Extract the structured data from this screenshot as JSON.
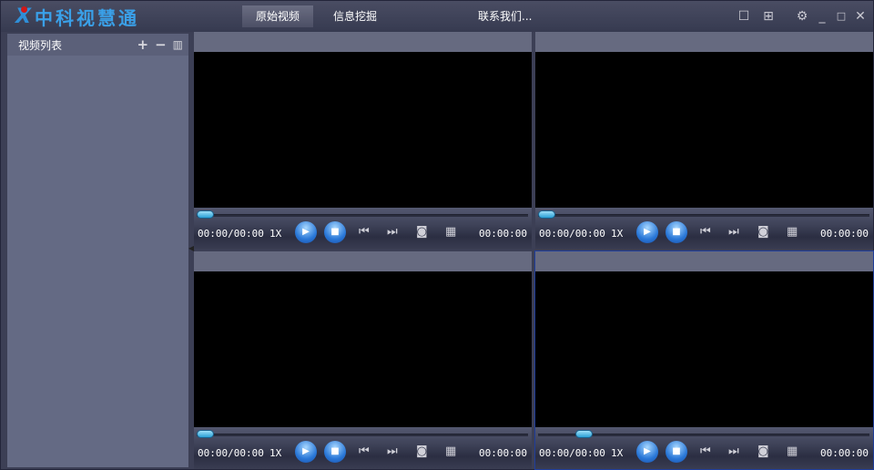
{
  "app": {
    "logo_text": "中科视慧通",
    "nav": [
      "原始视频",
      "信息挖掘",
      "联系我们..."
    ],
    "active_nav": 0,
    "window_icons": [
      "single-layout-icon",
      "quad-layout-icon",
      "settings-icon",
      "minimize-icon",
      "maximize-icon",
      "close-icon"
    ]
  },
  "sidebar": {
    "title": "视频列表",
    "actions": [
      "add-icon",
      "remove-icon",
      "delete-icon"
    ]
  },
  "colors": {
    "accent": "#2f8fd8",
    "selected_border": "#1f3d9a",
    "progress": "#2aa0d6"
  },
  "players": [
    {
      "elapsed": "00:00/00:00",
      "speed": "1X",
      "position": "00:00:00",
      "progress": 0.0,
      "selected": false
    },
    {
      "elapsed": "00:00/00:00",
      "speed": "1X",
      "position": "00:00:00",
      "progress": 0.0,
      "selected": false
    },
    {
      "elapsed": "00:00/00:00",
      "speed": "1X",
      "position": "00:00:00",
      "progress": 0.0,
      "selected": false
    },
    {
      "elapsed": "00:00/00:00",
      "speed": "1X",
      "position": "00:00:00",
      "progress": 0.12,
      "selected": true
    }
  ]
}
